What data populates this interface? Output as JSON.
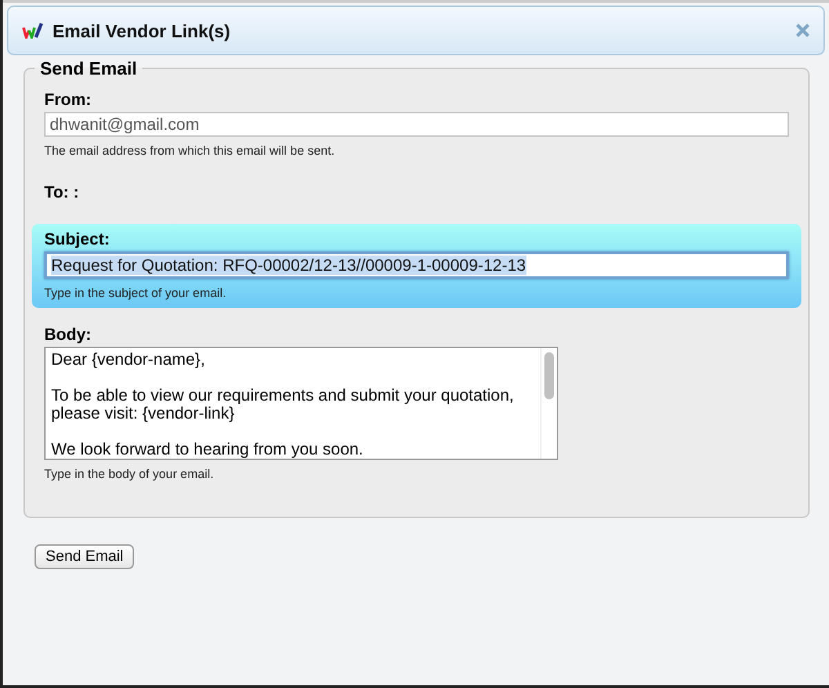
{
  "window": {
    "title": "Email Vendor Link(s)"
  },
  "fieldset": {
    "legend": "Send Email"
  },
  "fields": [
    {
      "kind": "input",
      "label": "From:",
      "value": "dhwanit@gmail.com",
      "hint": "The email address from which this email will be sent.",
      "focused": false
    },
    {
      "kind": "static",
      "label": "To: :",
      "focused": false
    },
    {
      "kind": "input",
      "label": "Subject:",
      "value": "Request for Quotation: RFQ-00002/12-13//00009-1-00009-12-13",
      "hint": "Type in the subject of your email.",
      "focused": true
    },
    {
      "kind": "textarea",
      "label": "Body:",
      "paragraphs": [
        "Dear {vendor-name},",
        "To be able to view our requirements and submit your quotation, please visit: {vendor-link}",
        "We look forward to hearing from you soon."
      ],
      "hint": "Type in the body of your email.",
      "focused": false
    }
  ],
  "buttons": [
    "Send Email"
  ]
}
